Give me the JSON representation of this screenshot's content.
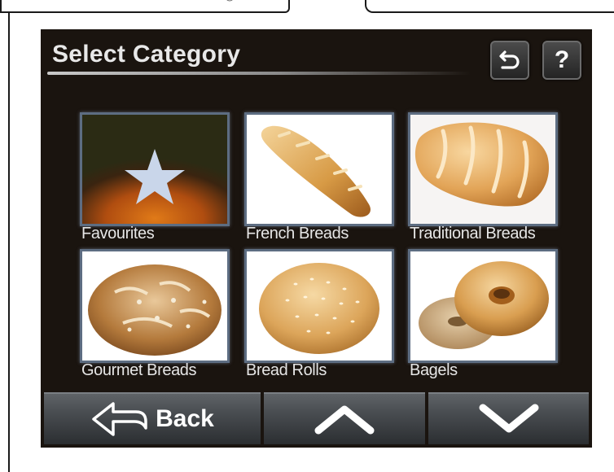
{
  "header": {
    "title": "Select Category",
    "return_icon": "return-arrow-icon",
    "help_label": "?"
  },
  "categories": [
    {
      "label": "Favourites",
      "icon": "star-icon"
    },
    {
      "label": "French Breads",
      "icon": "baguette-icon"
    },
    {
      "label": "Traditional Breads",
      "icon": "loaf-icon"
    },
    {
      "label": "Gourmet Breads",
      "icon": "round-loaf-icon"
    },
    {
      "label": "Bread Rolls",
      "icon": "bread-roll-icon"
    },
    {
      "label": "Bagels",
      "icon": "bagel-icon"
    }
  ],
  "footer": {
    "back_label": "Back",
    "up_icon": "chevron-up-icon",
    "down_icon": "chevron-down-icon"
  },
  "colors": {
    "screen_bg": "#1a140f",
    "button_gray": "#4a4e52",
    "tile_border": "#5d6d82",
    "text": "#e8e8e8"
  }
}
